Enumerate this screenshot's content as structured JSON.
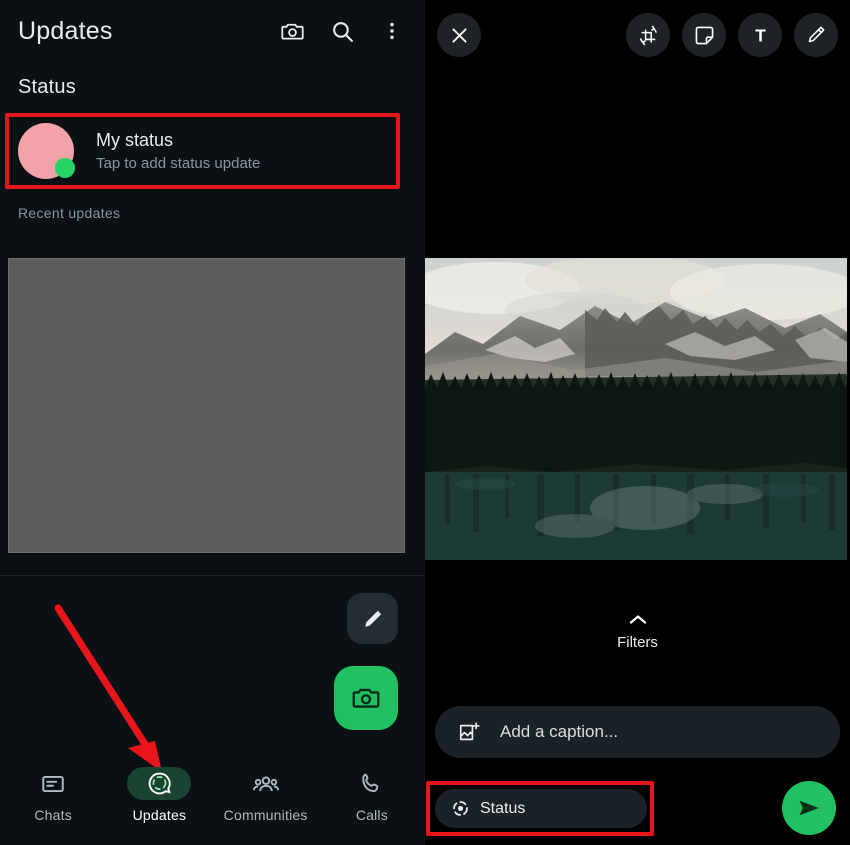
{
  "left_panel": {
    "header": {
      "title": "Updates",
      "icons": [
        {
          "name": "camera-icon",
          "label": "Camera"
        },
        {
          "name": "search-icon",
          "label": "Search"
        },
        {
          "name": "overflow-menu-icon",
          "label": "More options"
        }
      ]
    },
    "status_section": {
      "title": "Status",
      "my_status": {
        "name": "My status",
        "subtitle": "Tap to add status update",
        "avatar_color": "#f2a3aa",
        "badge_color": "#25d366",
        "highlighted": true,
        "highlight_color": "#e8161b"
      },
      "recent_updates_title": "Recent updates",
      "recent_placeholder_color": "#5c5c5c"
    },
    "fabs": [
      {
        "name": "edit-status-fab",
        "icon": "pencil-icon",
        "background": "#232d33"
      },
      {
        "name": "camera-status-fab",
        "icon": "camera-icon",
        "background": "#21c063"
      }
    ],
    "annotation": {
      "arrow_color": "#e8161b",
      "points_to": "Updates"
    },
    "bottom_nav": {
      "active": "Updates",
      "active_pill_color": "#1b4332",
      "items": [
        {
          "label": "Chats",
          "icon": "chats-icon",
          "active": false
        },
        {
          "label": "Updates",
          "icon": "status-ring-icon",
          "active": true
        },
        {
          "label": "Communities",
          "icon": "communities-icon",
          "active": false
        },
        {
          "label": "Calls",
          "icon": "phone-icon",
          "active": false
        }
      ]
    }
  },
  "right_panel": {
    "toolbar": {
      "close_label": "Close",
      "tools": [
        {
          "name": "crop-rotate-icon",
          "label": "Crop & rotate"
        },
        {
          "name": "sticker-icon",
          "label": "Sticker"
        },
        {
          "name": "text-icon",
          "label": "T"
        },
        {
          "name": "draw-pen-icon",
          "label": "Draw"
        }
      ]
    },
    "media": {
      "description": "Mountain lake with pine forest and snowy peaks"
    },
    "filters": {
      "label": "Filters",
      "chevron": "chevron-up-icon"
    },
    "caption": {
      "placeholder": "Add a caption...",
      "icon": "image-add-icon"
    },
    "recipient_chip": {
      "label": "Status",
      "icon": "status-ring-icon",
      "highlighted": true,
      "highlight_color": "#e8161b"
    },
    "send_button": {
      "label": "Send",
      "icon": "send-icon",
      "color": "#21c063"
    }
  }
}
